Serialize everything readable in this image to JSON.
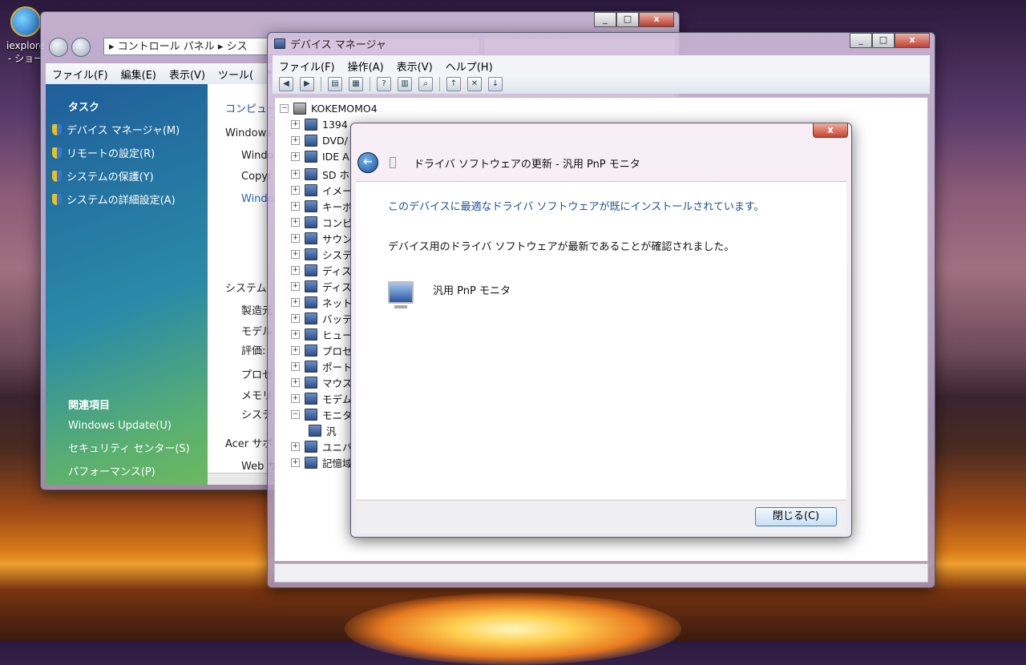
{
  "desktop": {
    "icon_label_1": "iexplore",
    "icon_label_2": "- ショー"
  },
  "control_panel": {
    "address": "▸ コントロール パネル ▸ シス",
    "menu": [
      "ファイル(F)",
      "編集(E)",
      "表示(V)",
      "ツール("
    ],
    "menu_more": "»",
    "tasks_heading": "タスク",
    "tasks": [
      "デバイス マネージャ(M)",
      "リモートの設定(R)",
      "システムの保護(Y)",
      "システムの詳細設定(A)"
    ],
    "related_heading": "関連項目",
    "related": [
      "Windows Update(U)",
      "セキュリティ センター(S)",
      "パフォーマンス(P)"
    ],
    "main": [
      "コンピュー",
      "Windows",
      "Windo",
      "Copyr",
      "Windo",
      "システム",
      "製造元",
      "モデル",
      "評価:",
      "プロセ",
      "メモリ",
      "システ",
      "Acer サポ",
      "Web サ"
    ]
  },
  "device_manager": {
    "title": "デバイス マネージャ",
    "menu": [
      "ファイル(F)",
      "操作(A)",
      "表示(V)",
      "ヘルプ(H)"
    ],
    "root": "KOKEMOMO4",
    "nodes": [
      "1394",
      "DVD/",
      "IDE A",
      "SD ホ",
      "イメー",
      "キーボ",
      "コンピ",
      "サウン",
      "システ",
      "ディス",
      "ディス",
      "ネット",
      "バッテ",
      "ヒュー",
      "プロセ",
      "ポート",
      "マウス",
      "モデム",
      "モニタ",
      "汎",
      "ユニバ",
      "記憶域"
    ]
  },
  "dialog": {
    "title": "ドライバ ソフトウェアの更新 - 汎用 PnP モニタ",
    "heading": "このデバイスに最適なドライバ ソフトウェアが既にインストールされています。",
    "message": "デバイス用のドライバ ソフトウェアが最新であることが確認されました。",
    "device_name": "汎用 PnP モニタ",
    "close_button": "閉じる(C)",
    "close_x": "x"
  }
}
